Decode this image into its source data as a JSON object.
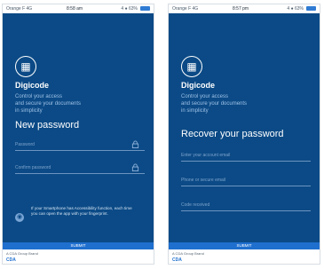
{
  "phones": [
    {
      "status": {
        "carrier": "Orange F 4G",
        "time": "8:58 am",
        "battery": "4 ● 63% "
      },
      "logo_mark": "▦",
      "brand": "Digicode",
      "tagline": "Control your access\nand secure your documents\nin simplicity",
      "title": "New password",
      "fields": [
        {
          "label": "Password",
          "icon": "lock-icon"
        },
        {
          "label": "Confirm password",
          "icon": "lock-icon"
        }
      ],
      "info": "If your Smartphone has Accessibility function, each time you can open the app with your fingerprint.",
      "submit": "SUBMIT",
      "footer_group": "A CDA Group Brand",
      "footer_mark": "CDA"
    },
    {
      "status": {
        "carrier": "Orange F 4G",
        "time": "8:57 pm",
        "battery": "4 ● 63% "
      },
      "logo_mark": "▦",
      "brand": "Digicode",
      "tagline": "Control your access\nand secure your documents\nin simplicity",
      "title": "Recover your password",
      "fields": [
        {
          "label": "Enter your account email"
        },
        {
          "label": "Phone or secure email"
        },
        {
          "label": "Code received"
        }
      ],
      "submit": "SUBMIT",
      "footer_group": "A CDA Group Brand",
      "footer_mark": "CDA"
    }
  ]
}
